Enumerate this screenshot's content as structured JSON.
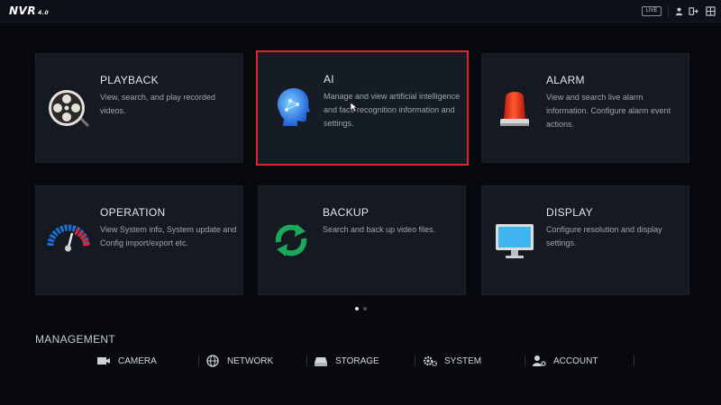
{
  "header": {
    "logo": "NVR",
    "logo_version": "4.0",
    "live_label": "LIVE"
  },
  "tiles": [
    {
      "title": "PLAYBACK",
      "description": "View, search, and play recorded videos.",
      "icon": "film-reel-icon"
    },
    {
      "title": "AI",
      "description": "Manage and view artificial intelligence and face recognition information and settings.",
      "icon": "ai-head-icon"
    },
    {
      "title": "ALARM",
      "description": "View and search live alarm information. Configure alarm event actions.",
      "icon": "alarm-light-icon"
    },
    {
      "title": "OPERATION",
      "description": "View System info, System update and Config import/export etc.",
      "icon": "gauge-icon"
    },
    {
      "title": "BACKUP",
      "description": "Search and back up video files.",
      "icon": "refresh-arrows-icon"
    },
    {
      "title": "DISPLAY",
      "description": "Configure resolution and display settings.",
      "icon": "monitor-icon"
    }
  ],
  "pager": {
    "pages": 2,
    "active": 1
  },
  "management": {
    "title": "MANAGEMENT",
    "items": [
      {
        "label": "CAMERA",
        "icon": "camera-icon"
      },
      {
        "label": "NETWORK",
        "icon": "globe-icon"
      },
      {
        "label": "STORAGE",
        "icon": "hard-drive-icon"
      },
      {
        "label": "SYSTEM",
        "icon": "gears-icon"
      },
      {
        "label": "ACCOUNT",
        "icon": "user-settings-icon"
      }
    ]
  },
  "colors": {
    "selection_border": "#e0262b",
    "tile_background": "#151a22",
    "page_background": "#07090d"
  }
}
